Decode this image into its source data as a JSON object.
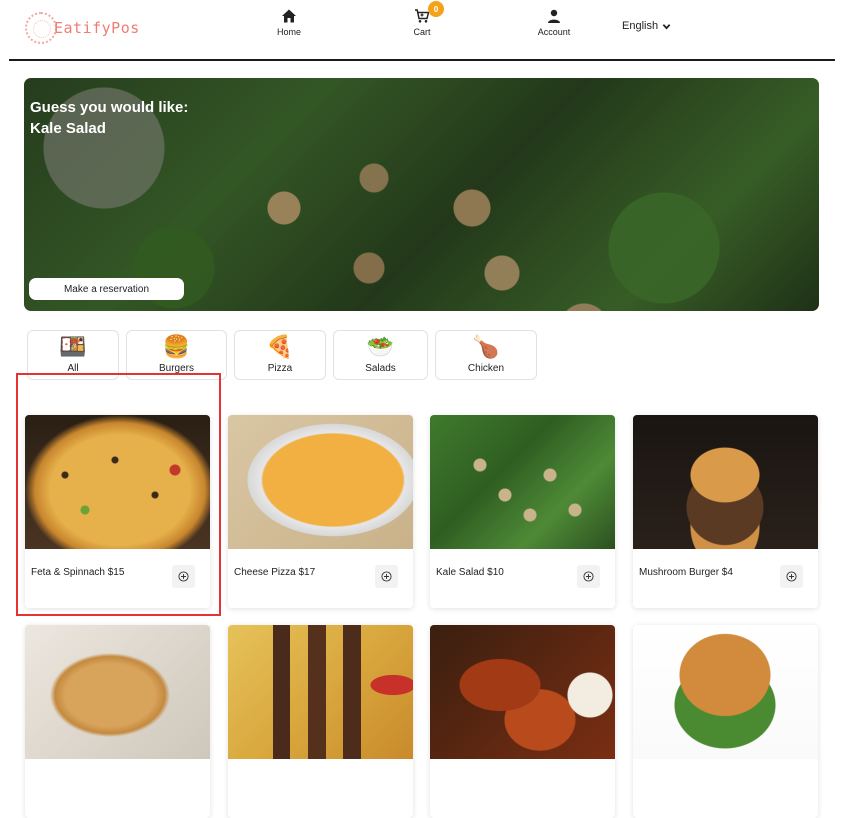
{
  "brand": {
    "name": "EatifyPos",
    "accent": "#ee7d73"
  },
  "nav": {
    "home": "Home",
    "cart": "Cart",
    "cart_count": "0",
    "account": "Account",
    "language": "English"
  },
  "hero": {
    "line1": "Guess you would like:",
    "line2": "Kale Salad",
    "reserve_label": "Make a reservation"
  },
  "categories": [
    {
      "label": "All",
      "icon": "all-food-icon"
    },
    {
      "label": "Burgers",
      "icon": "burger-icon"
    },
    {
      "label": "Pizza",
      "icon": "pizza-icon"
    },
    {
      "label": "Salads",
      "icon": "salad-icon"
    },
    {
      "label": "Chicken",
      "icon": "chicken-leg-icon"
    }
  ],
  "products": [
    {
      "name": "Feta & Spinnach $15"
    },
    {
      "name": "Cheese Pizza $17"
    },
    {
      "name": "Kale Salad $10"
    },
    {
      "name": "Mushroom Burger $4"
    }
  ],
  "selection_color": "#e53232"
}
